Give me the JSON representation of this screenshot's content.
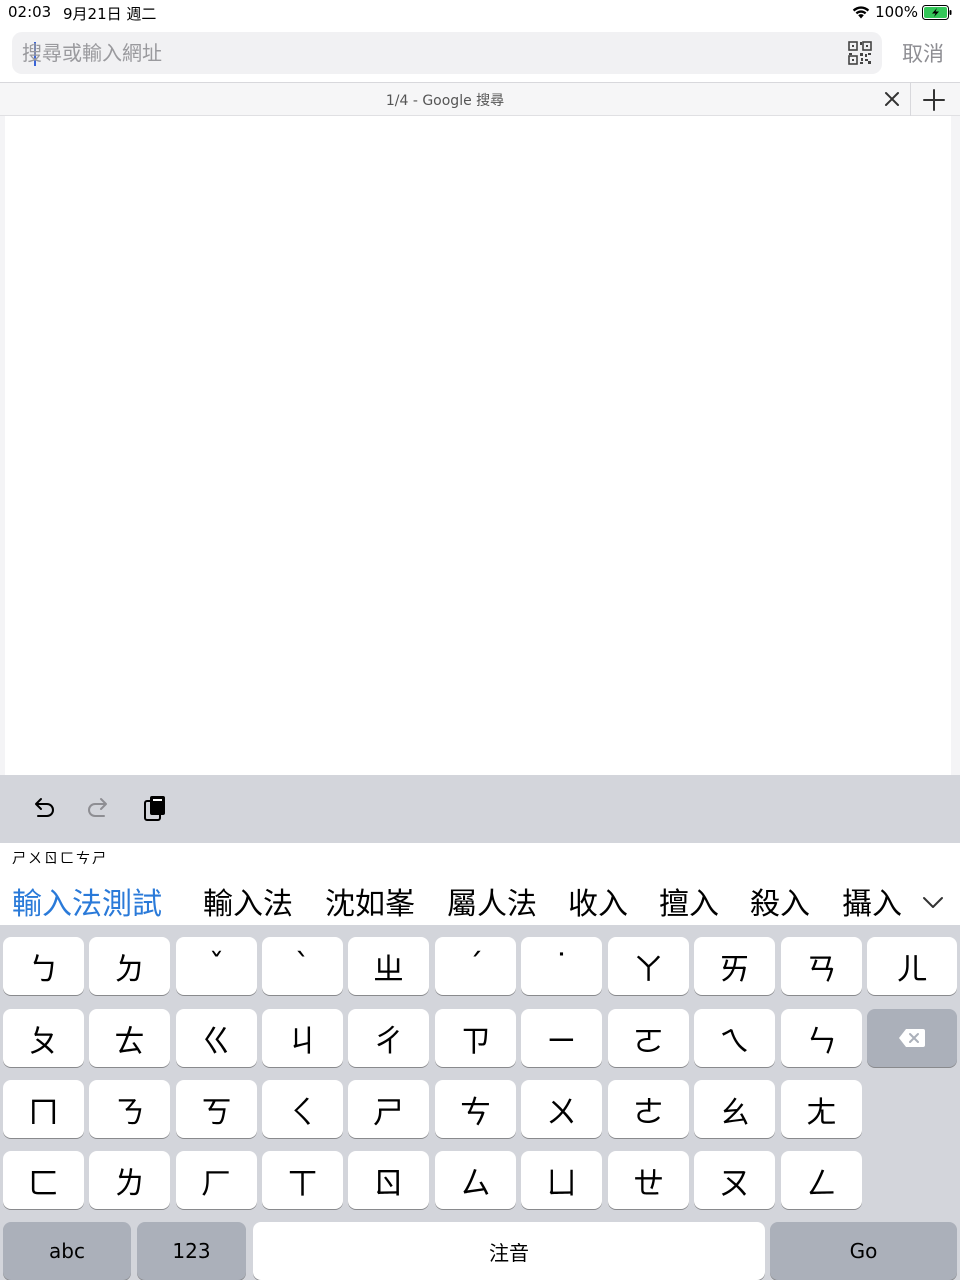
{
  "status_bar": {
    "time": "02:03",
    "date": "9月21日 週二",
    "battery": "100%",
    "battery_color": "#34c759"
  },
  "search": {
    "placeholder": "搜尋或輸入網址",
    "value": "",
    "qr_icon": "qr-code-icon",
    "cancel_label": "取消"
  },
  "tabs": {
    "current_title": "1/4 - Google 搜尋",
    "close_icon": "close-icon",
    "add_icon": "plus-icon"
  },
  "shortcut_bar": {
    "undo_icon": "undo-icon",
    "redo_icon": "redo-icon",
    "paste_icon": "paste-icon"
  },
  "ime": {
    "composition": "ㄕㄨㄖㄈㄘㄕ",
    "candidates": [
      "輸入法測試",
      "輸入法",
      "沈如峯",
      "屬人法",
      "收入",
      "擅入",
      "殺入",
      "攝入"
    ],
    "highlight_color": "#2a7ad9",
    "expand_icon": "chevron-down-icon"
  },
  "keyboard": {
    "row1": [
      "ㄅ",
      "ㄉ",
      "ˇ",
      "ˋ",
      "ㄓ",
      "ˊ",
      "˙",
      "ㄚ",
      "ㄞ",
      "ㄢ",
      "ㄦ"
    ],
    "row2": [
      "ㄆ",
      "ㄊ",
      "ㄍ",
      "ㄐ",
      "ㄔ",
      "ㄗ",
      "ㄧ",
      "ㄛ",
      "ㄟ",
      "ㄣ"
    ],
    "row3": [
      "ㄇ",
      "ㄋ",
      "ㄎ",
      "ㄑ",
      "ㄕ",
      "ㄘ",
      "ㄨ",
      "ㄜ",
      "ㄠ",
      "ㄤ"
    ],
    "row4": [
      "ㄈ",
      "ㄌ",
      "ㄏ",
      "ㄒ",
      "ㄖ",
      "ㄙ",
      "ㄩ",
      "ㄝ",
      "ㄡ",
      "ㄥ"
    ],
    "delete_icon": "backspace-icon",
    "abc_label": "abc",
    "num_label": "123",
    "space_label": "注音",
    "go_label": "Go"
  }
}
